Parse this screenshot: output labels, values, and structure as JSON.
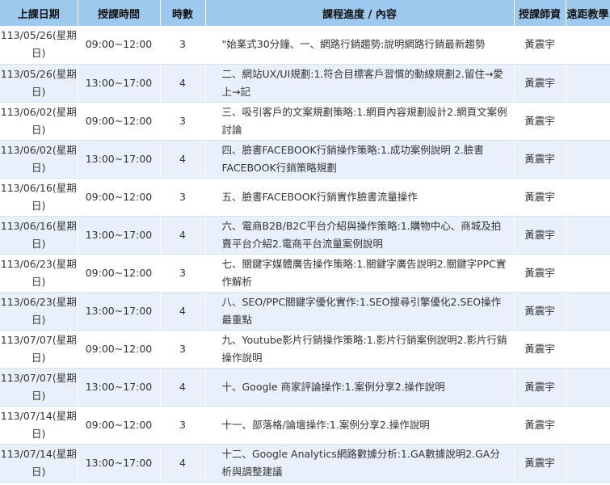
{
  "table": {
    "headers": {
      "date": "上課日期",
      "time": "授課時間",
      "hours": "時數",
      "content": "課程進度 / 內容",
      "teacher": "授課師資",
      "remote": "遠距教學"
    },
    "rows": [
      {
        "date": "113/05/26(星期日)",
        "time": "09:00~12:00",
        "hours": "3",
        "content": "\"始業式30分鐘、一、網路行銷趨勢:說明網路行銷最新趨勢",
        "teacher": "黃震宇",
        "remote": ""
      },
      {
        "date": "113/05/26(星期日)",
        "time": "13:00~17:00",
        "hours": "4",
        "content": "二、網站UX/UI規劃:1.符合目標客戶習慣的動線規劃2.留住→愛上→記",
        "teacher": "黃震宇",
        "remote": ""
      },
      {
        "date": "113/06/02(星期日)",
        "time": "09:00~12:00",
        "hours": "3",
        "content": "三、吸引客戶的文案規劃策略:1.網頁內容規劃設計2.網頁文案例討論",
        "teacher": "黃震宇",
        "remote": ""
      },
      {
        "date": "113/06/02(星期日)",
        "time": "13:00~17:00",
        "hours": "4",
        "content": "四、臉書FACEBOOK行銷操作策略:1.成功案例說明 2.臉書FACEBOOK行銷策略規劃",
        "teacher": "黃震宇",
        "remote": ""
      },
      {
        "date": "113/06/16(星期日)",
        "time": "09:00~12:00",
        "hours": "3",
        "content": "五、臉書FACEBOOK行銷實作臉書流量操作",
        "teacher": "黃震宇",
        "remote": ""
      },
      {
        "date": "113/06/16(星期日)",
        "time": "13:00~17:00",
        "hours": "4",
        "content": "六、電商B2B/B2C平台介紹與操作策略:1.購物中心、商城及拍賣平台介紹2.電商平台流量案例說明",
        "teacher": "黃震宇",
        "remote": ""
      },
      {
        "date": "113/06/23(星期日)",
        "time": "09:00~12:00",
        "hours": "3",
        "content": "七、關鍵字媒體廣告操作策略:1.關鍵字廣告說明2.關鍵字PPC實作解析",
        "teacher": "黃震宇",
        "remote": ""
      },
      {
        "date": "113/06/23(星期日)",
        "time": "13:00~17:00",
        "hours": "4",
        "content": "八、SEO/PPC關鍵字優化實作:1.SEO搜尋引擎優化2.SEO操作最重點",
        "teacher": "黃震宇",
        "remote": ""
      },
      {
        "date": "113/07/07(星期日)",
        "time": "09:00~12:00",
        "hours": "3",
        "content": "九、Youtube影片行銷操作策略:1.影片行銷案例說明2.影片行銷操作說明",
        "teacher": "黃震宇",
        "remote": ""
      },
      {
        "date": "113/07/07(星期日)",
        "time": "13:00~17:00",
        "hours": "4",
        "content": "十、Google 商家評論操作:1.案例分享2.操作說明",
        "teacher": "黃震宇",
        "remote": ""
      },
      {
        "date": "113/07/14(星期日)",
        "time": "09:00~12:00",
        "hours": "3",
        "content": "十一、部落格/論壇操作:1.案例分享2.操作說明",
        "teacher": "黃震宇",
        "remote": ""
      },
      {
        "date": "113/07/14(星期日)",
        "time": "13:00~17:00",
        "hours": "4",
        "content": "十二、Google Analytics網路數據分析:1.GA數據說明2.GA分析與調整建議",
        "teacher": "黃震宇",
        "remote": ""
      }
    ]
  }
}
